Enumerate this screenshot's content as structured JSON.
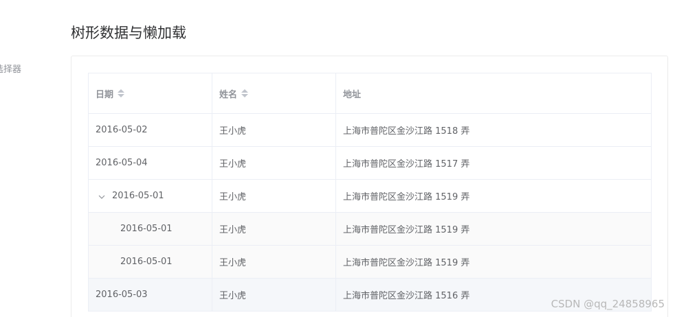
{
  "sidebar": {
    "partial_item": "选择器"
  },
  "page": {
    "title": "树形数据与懒加载"
  },
  "table": {
    "columns": [
      {
        "label": "日期",
        "sortable": true
      },
      {
        "label": "姓名",
        "sortable": true
      },
      {
        "label": "地址",
        "sortable": false
      }
    ],
    "rows": [
      {
        "date": "2016-05-02",
        "name": "王小虎",
        "address": "上海市普陀区金沙江路 1518 弄",
        "level": 0,
        "expandable": false,
        "expanded": false
      },
      {
        "date": "2016-05-04",
        "name": "王小虎",
        "address": "上海市普陀区金沙江路 1517 弄",
        "level": 0,
        "expandable": false,
        "expanded": false
      },
      {
        "date": "2016-05-01",
        "name": "王小虎",
        "address": "上海市普陀区金沙江路 1519 弄",
        "level": 0,
        "expandable": true,
        "expanded": true
      },
      {
        "date": "2016-05-01",
        "name": "王小虎",
        "address": "上海市普陀区金沙江路 1519 弄",
        "level": 1,
        "expandable": false,
        "expanded": false
      },
      {
        "date": "2016-05-01",
        "name": "王小虎",
        "address": "上海市普陀区金沙江路 1519 弄",
        "level": 1,
        "expandable": false,
        "expanded": false
      },
      {
        "date": "2016-05-03",
        "name": "王小虎",
        "address": "上海市普陀区金沙江路 1516 弄",
        "level": 0,
        "expandable": false,
        "expanded": false
      }
    ]
  },
  "watermark": "CSDN @qq_24858965"
}
